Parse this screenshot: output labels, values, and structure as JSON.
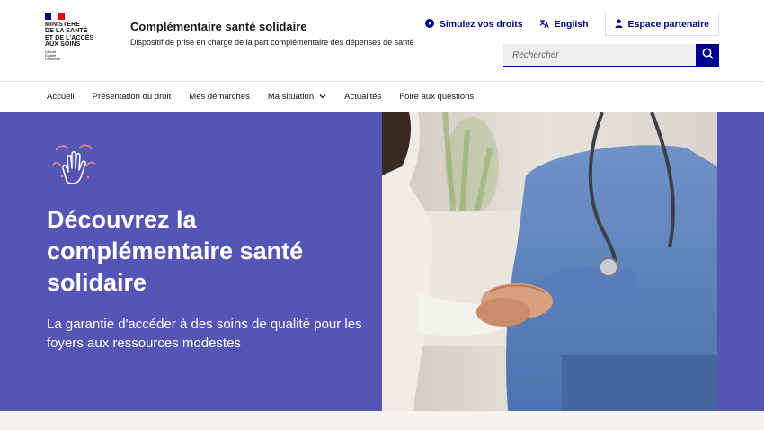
{
  "header": {
    "logo": {
      "ministry_lines": [
        "MINISTÈRE",
        "DE LA SANTÉ",
        "ET DE L'ACCÈS",
        "AUX SOINS"
      ],
      "motto_lines": [
        "Liberté",
        "Égalité",
        "Fraternité"
      ]
    },
    "service_title": "Complémentaire santé solidaire",
    "service_desc": "Dispositif de prise en charge de la part complémentaire des dépenses de santé",
    "tools": {
      "simulate": {
        "label": "Simulez vos droits",
        "icon": "play-circle-icon"
      },
      "language": {
        "label": "English",
        "icon": "translate-icon"
      },
      "partner": {
        "label": "Espace partenaire",
        "icon": "user-icon"
      }
    },
    "search": {
      "placeholder": "Rechercher",
      "value": ""
    }
  },
  "nav": {
    "items": [
      {
        "label": "Accueil"
      },
      {
        "label": "Présentation du droit"
      },
      {
        "label": "Mes démarches"
      },
      {
        "label": "Ma situation",
        "has_dropdown": true
      },
      {
        "label": "Actualités"
      },
      {
        "label": "Foire aux questions"
      }
    ]
  },
  "hero": {
    "title": "Découvrez la complémentaire santé solidaire",
    "subtitle": "La garantie d'accéder à des soins de qualité pour les foyers aux ressources modestes",
    "icon": "hands-care-icon",
    "photo": "caregiver-holding-hands-photo"
  },
  "colors": {
    "brand_blue": "#000091",
    "hero_bg": "#5455b5",
    "marianne_red": "#e1000f",
    "bottom_band": "#f6f3f0"
  }
}
